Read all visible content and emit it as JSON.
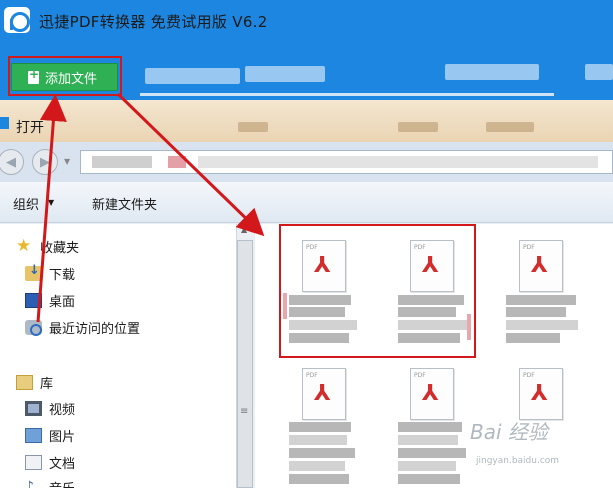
{
  "app": {
    "title": "迅捷PDF转换器 免费试用版 V6.2",
    "add_file_label": "添加文件"
  },
  "dialog": {
    "title": "打开",
    "organize_label": "组织",
    "new_folder_label": "新建文件夹"
  },
  "nav_pane": {
    "favorites_label": "收藏夹",
    "favorites": [
      {
        "label": "下载",
        "icon": "download-folder-icon"
      },
      {
        "label": "桌面",
        "icon": "desktop-icon"
      },
      {
        "label": "最近访问的位置",
        "icon": "recent-places-icon"
      }
    ],
    "library_label": "库",
    "libraries": [
      {
        "label": "视频",
        "icon": "video-icon"
      },
      {
        "label": "图片",
        "icon": "picture-icon"
      },
      {
        "label": "文档",
        "icon": "document-icon"
      },
      {
        "label": "音乐",
        "icon": "music-icon"
      }
    ]
  },
  "watermark": {
    "text": "Bai 经验",
    "sub": "jingyan.baidu.com"
  },
  "colors": {
    "app_blue": "#1c86e0",
    "add_button_green": "#2fb055",
    "highlight_red": "#d3181c",
    "pdf_red": "#d32c2c"
  }
}
